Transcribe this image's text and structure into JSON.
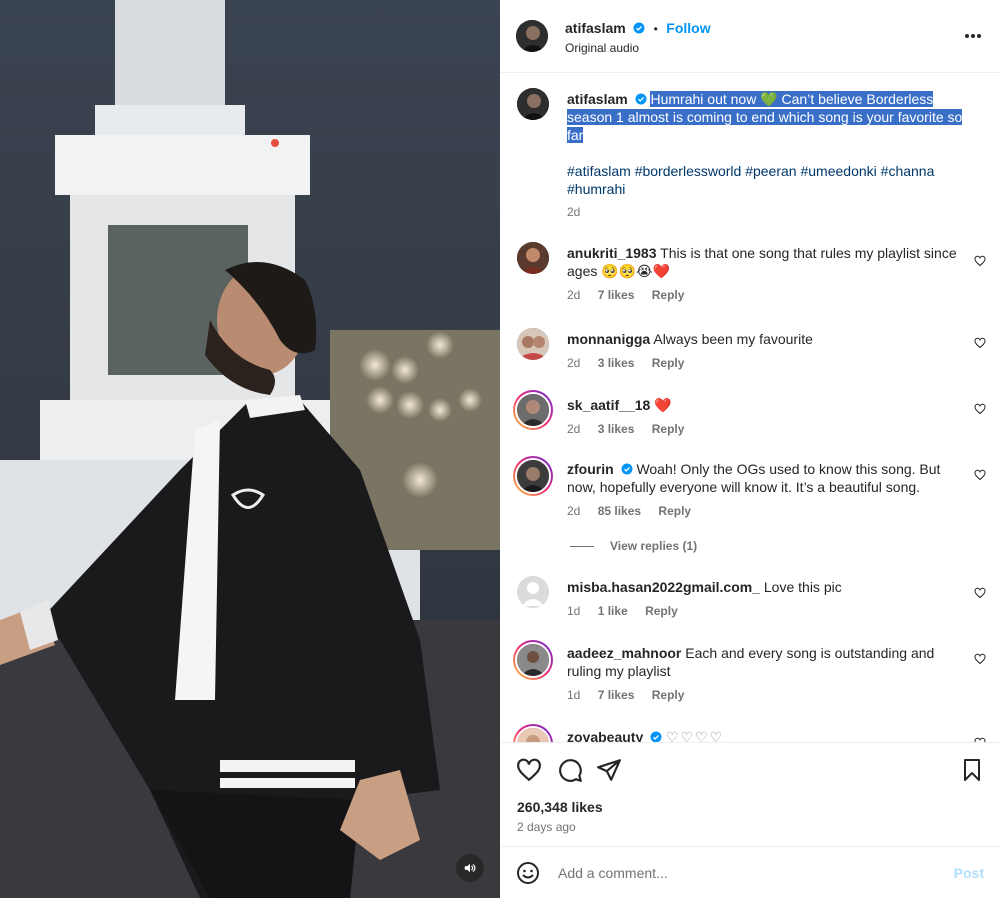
{
  "header": {
    "username": "atifaslam",
    "separator": "•",
    "follow_label": "Follow",
    "subtitle": "Original audio"
  },
  "caption": {
    "username": "atifaslam",
    "text": "Humrahi out now 💚 Can’t believe Borderless season 1 almost is coming to end which song is your favorite so far",
    "hashtags": [
      "#atifaslam",
      "#borderlessworld",
      "#peeran",
      "#umeedonki",
      "#channa",
      "#humrahi"
    ],
    "time": "2d"
  },
  "comments": [
    {
      "username": "anukriti_1983",
      "text": "This is that one song that rules my playlist since ages 🥺🥺😭❤️",
      "time": "2d",
      "likes": "7 likes",
      "reply": "Reply"
    },
    {
      "username": "monnanigga",
      "text": "Always been my favourite",
      "time": "2d",
      "likes": "3 likes",
      "reply": "Reply"
    },
    {
      "username": "sk_aatif__18",
      "text": "❤️",
      "time": "2d",
      "likes": "3 likes",
      "reply": "Reply"
    },
    {
      "username": "zfourin",
      "text": "Woah! Only the OGs used to know this song. But now, hopefully everyone will know it. It’s a beautiful song.",
      "time": "2d",
      "likes": "85 likes",
      "reply": "Reply",
      "view_replies": "View replies (1)"
    },
    {
      "username": "misba.hasan2022gmail.com_",
      "text": "Love this pic",
      "time": "1d",
      "likes": "1 like",
      "reply": "Reply"
    },
    {
      "username": "aadeez_mahnoor",
      "text": "Each and every song is outstanding and ruling my playlist",
      "time": "1d",
      "likes": "7 likes",
      "reply": "Reply"
    },
    {
      "username": "zoyabeauty",
      "text": "♡♡♡♡"
    }
  ],
  "footer": {
    "likes": "260,348 likes",
    "time_ago": "2 days ago",
    "comment_placeholder": "Add a comment...",
    "post_label": "Post"
  },
  "icons": {
    "like": "heart-icon",
    "comment": "comment-icon",
    "share": "share-icon",
    "save": "bookmark-icon",
    "emoji": "emoji-icon",
    "more": "more-icon",
    "mute": "speaker-icon"
  },
  "colors": {
    "follow": "#0095f6",
    "highlight": "#3a6fc7",
    "hashtag": "#00376b",
    "post_disabled": "#b2dffc"
  }
}
